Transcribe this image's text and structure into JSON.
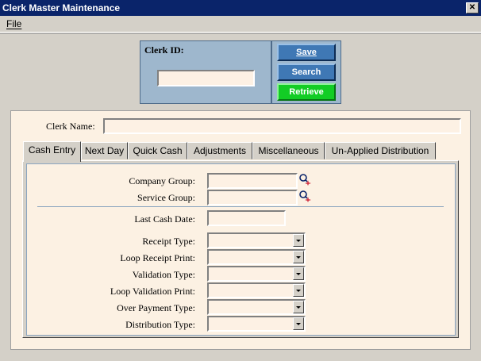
{
  "window": {
    "title": "Clerk Master Maintenance",
    "close_glyph": "✕"
  },
  "menu": {
    "file": "File"
  },
  "header": {
    "clerk_id_label": "Clerk ID:",
    "clerk_id_value": "",
    "buttons": {
      "save": "Save",
      "search": "Search",
      "retrieve": "Retrieve"
    }
  },
  "form": {
    "clerk_name_label": "Clerk Name:",
    "clerk_name_value": ""
  },
  "tabs": [
    "Cash Entry",
    "Next Day",
    "Quick Cash",
    "Adjustments",
    "Miscellaneous",
    "Un-Applied Distribution"
  ],
  "cash_entry": {
    "company_group_label": "Company Group:",
    "service_group_label": "Service Group:",
    "last_cash_date_label": "Last Cash Date:",
    "receipt_type_label": "Receipt Type:",
    "loop_receipt_print_label": "Loop Receipt Print:",
    "validation_type_label": "Validation Type:",
    "loop_validation_print_label": "Loop Validation Print:",
    "over_payment_type_label": "Over Payment Type:",
    "distribution_type_label": "Distribution Type:"
  },
  "colors": {
    "titlebar": "#0a246a",
    "button_blue": "#3f78b5",
    "button_green": "#12cd25",
    "field_bg": "#fdf1e4"
  },
  "icons": {
    "lookup": "magnifier-sparkle-icon"
  }
}
